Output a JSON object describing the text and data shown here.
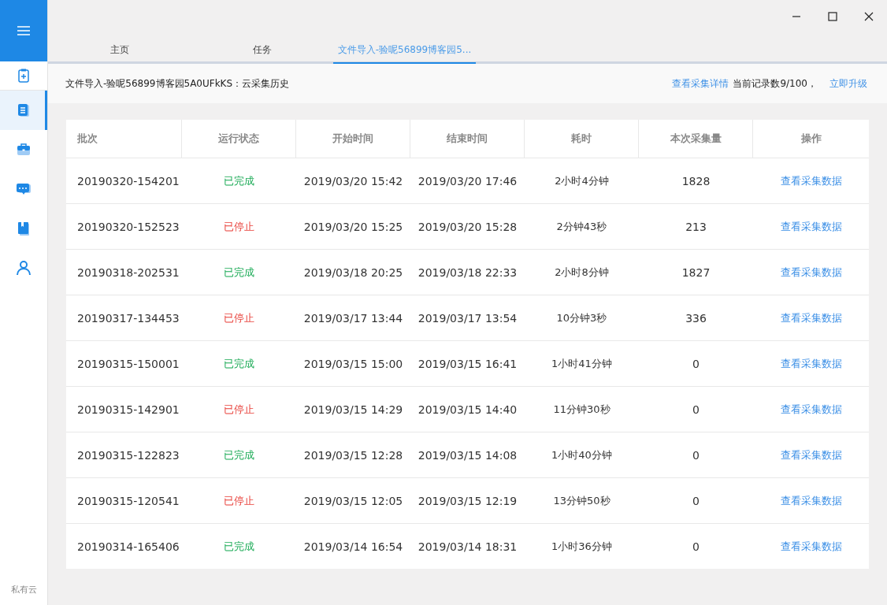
{
  "sidebar": {
    "items": [
      {
        "kind": "clipboard",
        "selected": false
      },
      {
        "kind": "document",
        "selected": true
      },
      {
        "kind": "briefcase",
        "selected": false
      },
      {
        "kind": "chat",
        "selected": false
      },
      {
        "kind": "book",
        "selected": false
      },
      {
        "kind": "user",
        "selected": false
      }
    ],
    "footer": "私有云"
  },
  "tabs": [
    {
      "label": "主页",
      "selected": false
    },
    {
      "label": "任务",
      "selected": false
    },
    {
      "label": "文件导入-验呢56899博客园5...",
      "selected": true
    }
  ],
  "header": {
    "title": "文件导入-验呢56899博客园5A0UFkKS：云采集历史",
    "details_link": "查看采集详情",
    "record_count": "当前记录数9/100，",
    "upgrade_link": "立即升级"
  },
  "table": {
    "columns": [
      "批次",
      "运行状态",
      "开始时间",
      "结束时间",
      "耗时",
      "本次采集量",
      "操作"
    ],
    "rows": [
      {
        "batch": "20190320-154201",
        "status": "已完成",
        "kind": "done",
        "start": "2019/03/20 15:42",
        "end": "2019/03/20 17:46",
        "duration": "2小时4分钟",
        "count": "1828",
        "action": "查看采集数据"
      },
      {
        "batch": "20190320-152523",
        "status": "已停止",
        "kind": "stopped",
        "start": "2019/03/20 15:25",
        "end": "2019/03/20 15:28",
        "duration": "2分钟43秒",
        "count": "213",
        "action": "查看采集数据"
      },
      {
        "batch": "20190318-202531",
        "status": "已完成",
        "kind": "done",
        "start": "2019/03/18 20:25",
        "end": "2019/03/18 22:33",
        "duration": "2小时8分钟",
        "count": "1827",
        "action": "查看采集数据"
      },
      {
        "batch": "20190317-134453",
        "status": "已停止",
        "kind": "stopped",
        "start": "2019/03/17 13:44",
        "end": "2019/03/17 13:54",
        "duration": "10分钟3秒",
        "count": "336",
        "action": "查看采集数据"
      },
      {
        "batch": "20190315-150001",
        "status": "已完成",
        "kind": "done",
        "start": "2019/03/15 15:00",
        "end": "2019/03/15 16:41",
        "duration": "1小时41分钟",
        "count": "0",
        "action": "查看采集数据"
      },
      {
        "batch": "20190315-142901",
        "status": "已停止",
        "kind": "stopped",
        "start": "2019/03/15 14:29",
        "end": "2019/03/15 14:40",
        "duration": "11分钟30秒",
        "count": "0",
        "action": "查看采集数据"
      },
      {
        "batch": "20190315-122823",
        "status": "已完成",
        "kind": "done",
        "start": "2019/03/15 12:28",
        "end": "2019/03/15 14:08",
        "duration": "1小时40分钟",
        "count": "0",
        "action": "查看采集数据"
      },
      {
        "batch": "20190315-120541",
        "status": "已停止",
        "kind": "stopped",
        "start": "2019/03/15 12:05",
        "end": "2019/03/15 12:19",
        "duration": "13分钟50秒",
        "count": "0",
        "action": "查看采集数据"
      },
      {
        "batch": "20190314-165406",
        "status": "已完成",
        "kind": "done",
        "start": "2019/03/14 16:54",
        "end": "2019/03/14 18:31",
        "duration": "1小时36分钟",
        "count": "0",
        "action": "查看采集数据"
      }
    ]
  }
}
